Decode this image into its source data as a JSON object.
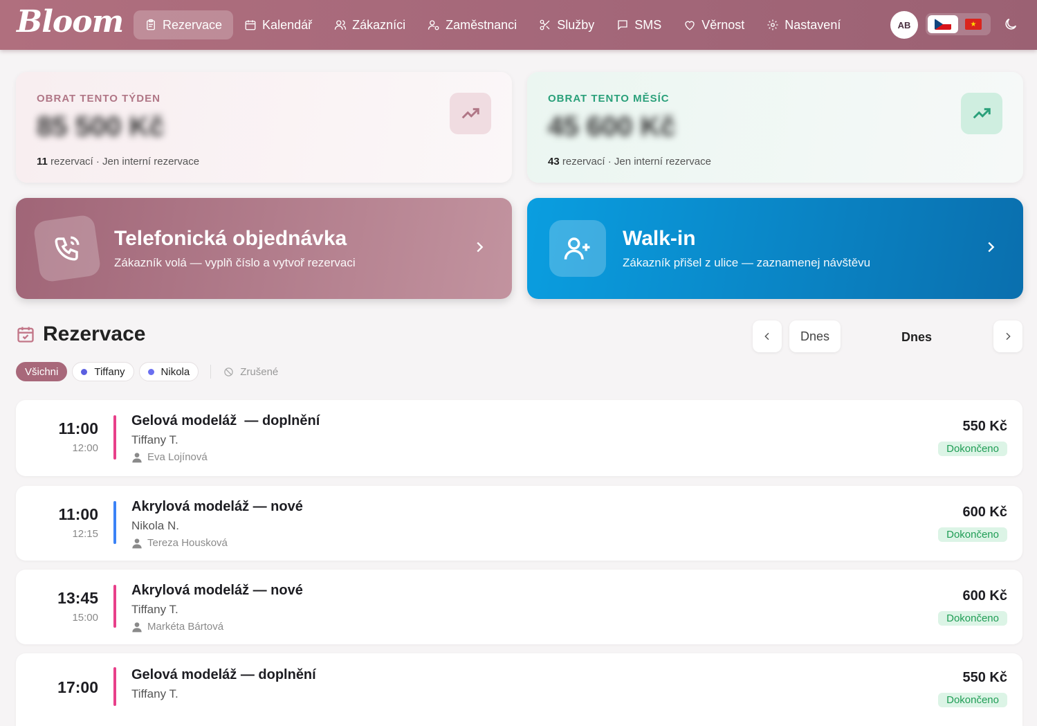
{
  "brand": {
    "logo": "Bloom"
  },
  "nav": {
    "items": [
      {
        "label": "Rezervace",
        "icon": "clipboard-icon",
        "active": true
      },
      {
        "label": "Kalendář",
        "icon": "calendar-icon"
      },
      {
        "label": "Zákazníci",
        "icon": "users-icon"
      },
      {
        "label": "Zaměstnanci",
        "icon": "user-gear-icon"
      },
      {
        "label": "Služby",
        "icon": "scissors-icon"
      },
      {
        "label": "SMS",
        "icon": "message-icon"
      },
      {
        "label": "Věrnost",
        "icon": "heart-icon"
      },
      {
        "label": "Nastavení",
        "icon": "gear-icon"
      }
    ],
    "avatar": "AB",
    "languages": [
      "cz",
      "vn"
    ],
    "active_language": "cz"
  },
  "stats": {
    "week": {
      "label": "OBRAT TENTO TÝDEN",
      "value": "85 500 Kč",
      "count": "11",
      "count_suffix": " rezervací · Jen interní rezervace"
    },
    "month": {
      "label": "OBRAT TENTO MĚSÍC",
      "value": "45 600 Kč",
      "count": "43",
      "count_suffix": " rezervací · Jen interní rezervace"
    }
  },
  "actions": {
    "phone": {
      "title": "Telefonická objednávka",
      "desc": "Zákazník volá — vyplň číslo a vytvoř rezervaci"
    },
    "walkin": {
      "title": "Walk-in",
      "desc": "Zákazník přišel z ulice — zaznamenej návštěvu"
    }
  },
  "reservations": {
    "title": "Rezervace",
    "today_button": "Dnes",
    "date_label": "Dnes",
    "filters": {
      "all": "Všichni",
      "staff": [
        {
          "name": "Tiffany",
          "color": "#5b5fe0"
        },
        {
          "name": "Nikola",
          "color": "#6a6ff0"
        }
      ],
      "cancelled": "Zrušené"
    },
    "items": [
      {
        "start": "11:00",
        "end": "12:00",
        "service": "Gelová modeláž  — doplnění",
        "customer": "Tiffany T.",
        "staff": "Eva Lojínová",
        "price": "550 Kč",
        "status": "Dokončeno",
        "color": "#e8408a"
      },
      {
        "start": "11:00",
        "end": "12:15",
        "service": "Akrylová modeláž — nové",
        "customer": "Nikola N.",
        "staff": "Tereza Housková",
        "price": "600 Kč",
        "status": "Dokončeno",
        "color": "#3b82f6"
      },
      {
        "start": "13:45",
        "end": "15:00",
        "service": "Akrylová modeláž — nové",
        "customer": "Tiffany T.",
        "staff": "Markéta Bártová",
        "price": "600 Kč",
        "status": "Dokončeno",
        "color": "#e8408a"
      },
      {
        "start": "17:00",
        "end": "",
        "service": "Gelová modeláž — doplnění",
        "customer": "Tiffany T.",
        "staff": "",
        "price": "550 Kč",
        "status": "Dokončeno",
        "color": "#e8408a"
      }
    ]
  },
  "colors": {
    "brand": "#a8687a",
    "walkin": "#0a8fd0",
    "success": "#1f9d55"
  }
}
